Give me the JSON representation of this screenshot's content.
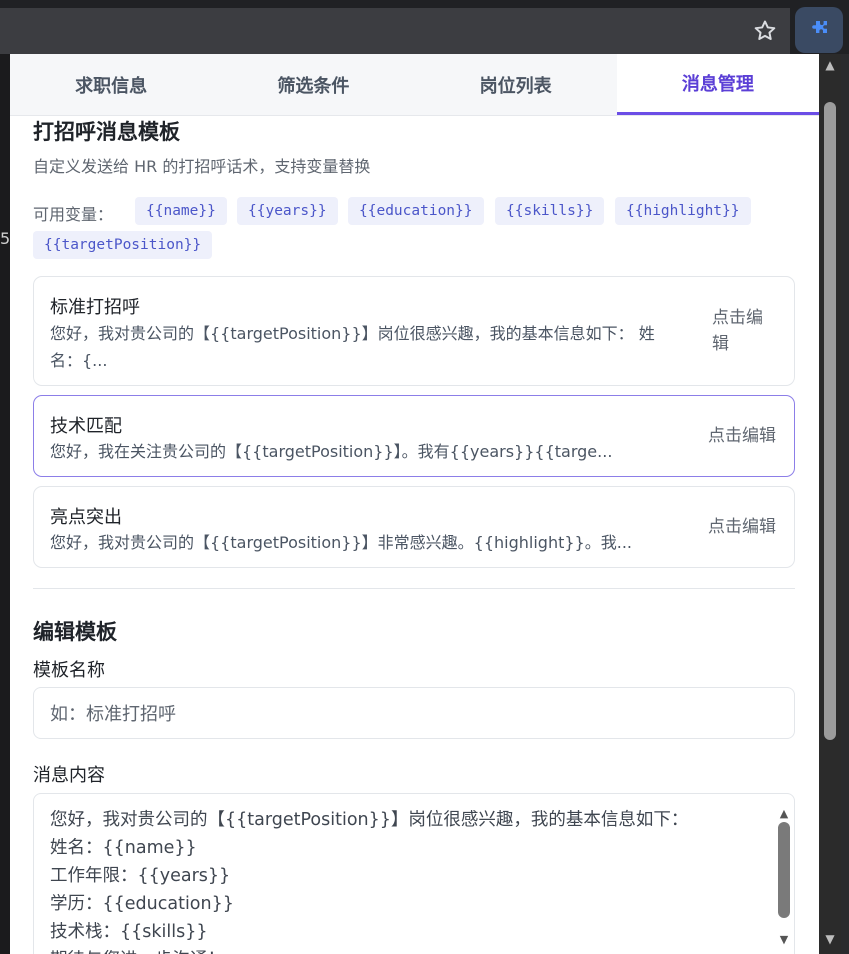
{
  "browser": {
    "left_digit": "5",
    "star_icon": "star-icon",
    "extension_icon": "puzzle-icon"
  },
  "tabs": [
    {
      "label": "求职信息"
    },
    {
      "label": "筛选条件"
    },
    {
      "label": "岗位列表"
    },
    {
      "label": "消息管理",
      "active": true
    }
  ],
  "templates_section": {
    "title": "打招呼消息模板",
    "description": "自定义发送给 HR 的打招呼话术，支持变量替换",
    "vars_label": "可用变量：",
    "vars": [
      "{{name}}",
      "{{years}}",
      "{{education}}",
      "{{skills}}",
      "{{highlight}}",
      "{{targetPosition}}"
    ]
  },
  "cards": [
    {
      "title": "标准打招呼",
      "body_line1": "您好，我对贵公司的【{{targetPosition}}】岗位很感兴趣，我的基本信息如下： 姓",
      "body_line2": "名：{...",
      "edit_line1": "点击编",
      "edit_line2": "辑"
    },
    {
      "title": "技术匹配",
      "body": "您好，我在关注贵公司的【{{targetPosition}}】。我有{{years}}{{targe...",
      "edit": "点击编辑",
      "selected": true
    },
    {
      "title": "亮点突出",
      "body": "您好，我对贵公司的【{{targetPosition}}】非常感兴趣。{{highlight}}。我...",
      "edit": "点击编辑"
    }
  ],
  "edit_section": {
    "title": "编辑模板",
    "name_label": "模板名称",
    "name_placeholder": "如：标准打招呼",
    "content_label": "消息内容",
    "content_lines": [
      "您好，我对贵公司的【{{targetPosition}}】岗位很感兴趣，我的基本信息如下：",
      "姓名：{{name}}",
      "工作年限：{{years}}",
      "学历：{{education}}",
      "技术栈：{{skills}}",
      "期待与您进一步沟通！"
    ]
  },
  "colors": {
    "accent": "#6b4de6",
    "chip_bg": "#eef0fb",
    "chip_text": "#4b56c9"
  }
}
